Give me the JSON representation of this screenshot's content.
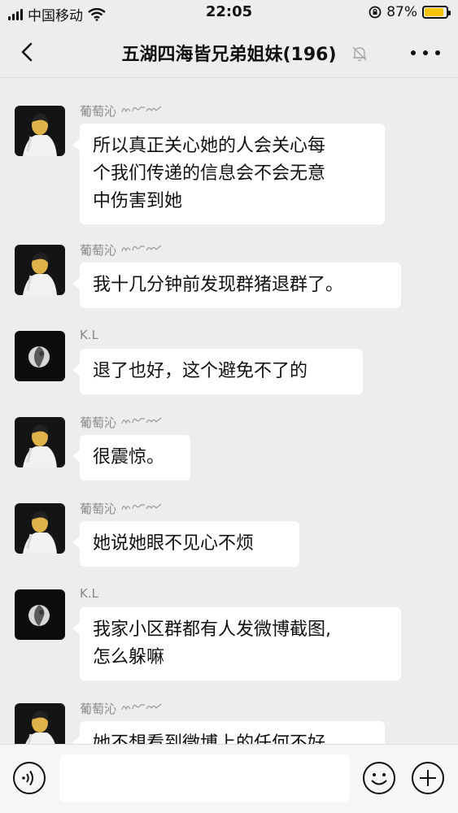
{
  "status_bar": {
    "carrier": "中国移动",
    "time": "22:05",
    "battery": "87%",
    "battery_level": 0.87,
    "icons": [
      "signal-icon",
      "wifi-icon",
      "orientation-lock-icon",
      "battery-icon"
    ]
  },
  "nav": {
    "title": "五湖四海皆兄弟姐妹(196)",
    "icons": [
      "back-icon",
      "mute-icon",
      "more-icon"
    ]
  },
  "messages": [
    {
      "sender": "葡萄沁",
      "avatar": "portrait-avatar",
      "lines": [
        "所以真正关心她的人会关心每",
        "个我们传递的信息会不会无意",
        "中伤害到她"
      ]
    },
    {
      "sender": "葡萄沁",
      "avatar": "portrait-avatar",
      "lines": [
        "我十几分钟前发现群猪退群了。"
      ]
    },
    {
      "sender": "K.L",
      "avatar": "moon-avatar",
      "lines": [
        "退了也好，这个避免不了的"
      ]
    },
    {
      "sender": "葡萄沁",
      "avatar": "portrait-avatar",
      "lines": [
        "很震惊。"
      ]
    },
    {
      "sender": "葡萄沁",
      "avatar": "portrait-avatar",
      "lines": [
        "她说她眼不见心不烦"
      ]
    },
    {
      "sender": "K.L",
      "avatar": "moon-avatar",
      "lines": [
        "我家小区群都有人发微博截图,",
        "怎么躲嘛"
      ]
    },
    {
      "sender": "葡萄沁",
      "avatar": "portrait-avatar",
      "lines": [
        "她不想看到微博上的任何不好"
      ]
    }
  ],
  "input_bar": {
    "icons": [
      "voice-icon",
      "emoji-icon",
      "plus-icon"
    ]
  },
  "colors": {
    "background": "#ededed",
    "bubble": "#ffffff",
    "sender_text": "#888888",
    "battery_fill": "#f2c500"
  }
}
